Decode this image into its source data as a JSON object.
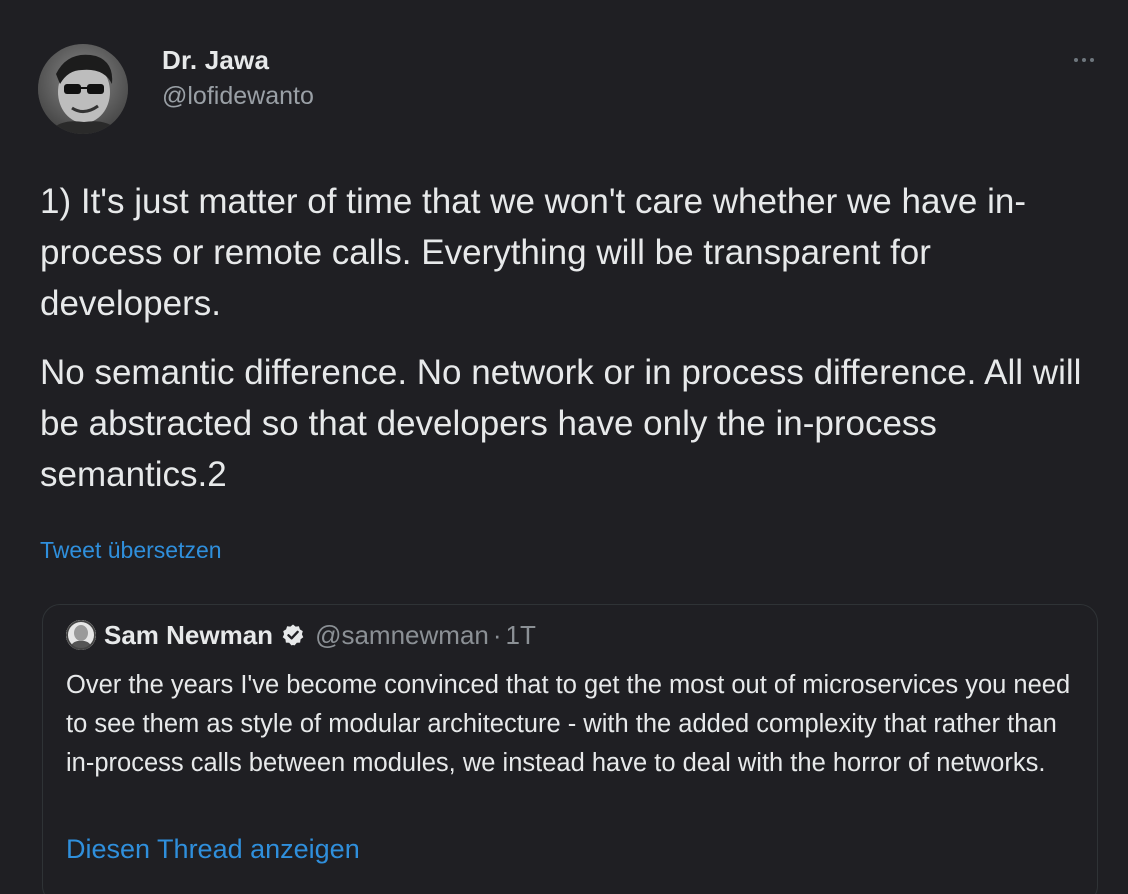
{
  "author": {
    "name": "Dr. Jawa",
    "handle": "@lofidewanto",
    "avatar_icon": "profile-photo"
  },
  "more_icon": "more-dots-icon",
  "tweet": {
    "paragraphs": [
      "1) It's just matter of time that we won't care whether we have in-process or remote calls. Everything will be transparent for developers.",
      "No semantic difference. No network or in process difference. All will be abstracted so that developers have only the in-process semantics.2"
    ],
    "translate_label": "Tweet übersetzen"
  },
  "quoted_tweet": {
    "author_name": "Sam Newman",
    "verified": true,
    "handle": "@samnewman",
    "separator": "·",
    "time": "1T",
    "text": "Over the years I've become convinced that to get the most out of microservices you need to see them as style of modular architecture - with the added complexity that rather than in-process calls between modules, we instead have to deal with the horror of networks.",
    "thread_link_label": "Diesen Thread anzeigen"
  },
  "colors": {
    "background": "#1f1f23",
    "text": "#e7e9ea",
    "secondary": "#9aa0a6",
    "link": "#2f8fdc",
    "verified": "#e7e9ea"
  }
}
